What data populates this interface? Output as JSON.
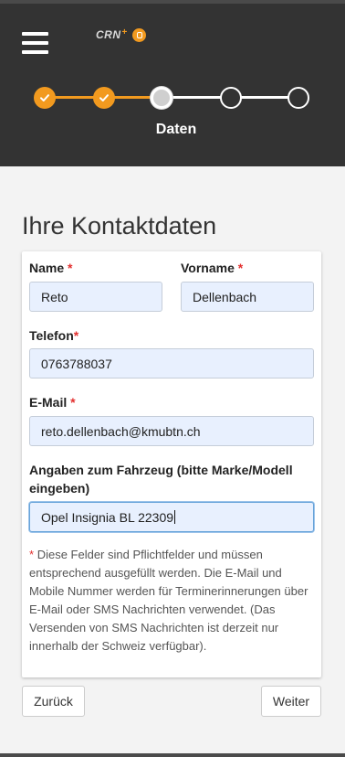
{
  "header": {
    "logo_text": "CRN",
    "logo_mark": "+",
    "colors": {
      "background": "#333333",
      "accent": "#f29a1f"
    },
    "steps": [
      {
        "state": "done",
        "icon": "check-icon"
      },
      {
        "state": "done",
        "icon": "check-icon"
      },
      {
        "state": "current"
      },
      {
        "state": "todo"
      },
      {
        "state": "todo"
      }
    ],
    "current_step_label": "Daten"
  },
  "page": {
    "title": "Ihre Kontaktdaten"
  },
  "form": {
    "required_marker": "*",
    "name": {
      "label": "Name",
      "value": "Reto"
    },
    "vorname": {
      "label": "Vorname",
      "value": "Dellenbach"
    },
    "telefon": {
      "label": "Telefon",
      "value": "0763788037"
    },
    "email": {
      "label": "E-Mail",
      "value": "reto.dellenbach@kmubtn.ch"
    },
    "fahrzeug": {
      "label": "Angaben zum Fahrzeug (bitte Marke/Modell eingeben)",
      "value": "Opel Insignia BL 22309"
    },
    "note": "Diese Felder sind Pflichtfelder und müssen entsprechend ausgefüllt werden. Die E-Mail und Mobile Nummer werden für Terminerinnerungen über E-Mail oder SMS Nachrichten verwendet. (Das Versenden von SMS Nachrichten ist derzeit nur innerhalb der Schweiz verfügbar)."
  },
  "nav": {
    "back_label": "Zurück",
    "next_label": "Weiter"
  }
}
